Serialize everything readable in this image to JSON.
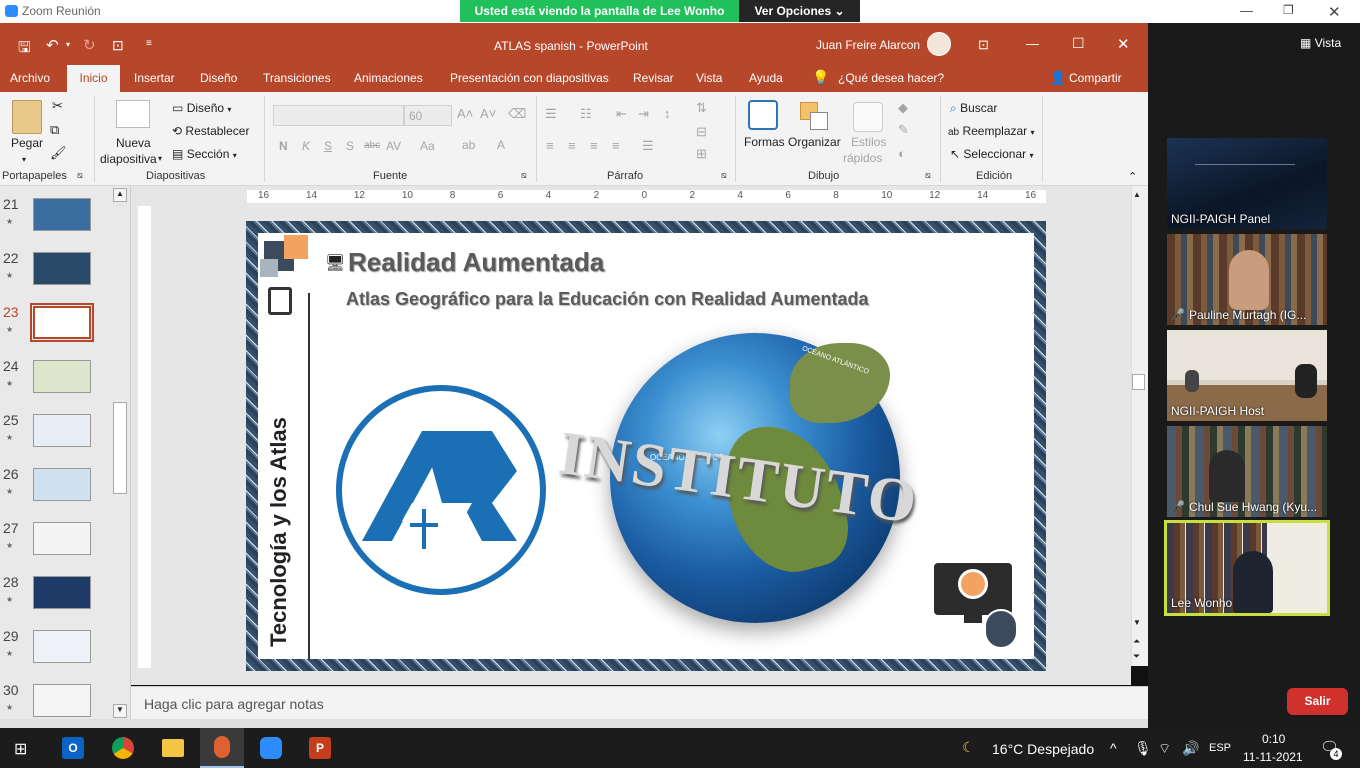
{
  "zoom": {
    "window_title": "Zoom Reunión",
    "share_banner": "Usted está viendo la pantalla de Lee Wonho",
    "view_options": "Ver Opciones",
    "view_label": "Vista",
    "leave_label": "Salir",
    "participants": [
      {
        "name": "NGII-PAIGH Panel",
        "muted": false
      },
      {
        "name": "Pauline Murtagh (IG...",
        "muted": true
      },
      {
        "name": "NGII-PAIGH Host",
        "muted": false
      },
      {
        "name": "Chul Sue Hwang (Kyu...",
        "muted": true
      },
      {
        "name": "Lee Wonho",
        "muted": false,
        "active_speaker": true
      }
    ]
  },
  "powerpoint": {
    "title": "ATLAS spanish  -  PowerPoint",
    "user": "Juan Freire Alarcon",
    "tabs": [
      "Archivo",
      "Inicio",
      "Insertar",
      "Diseño",
      "Transiciones",
      "Animaciones",
      "Presentación con diapositivas",
      "Revisar",
      "Vista",
      "Ayuda",
      "¿Qué desea hacer?"
    ],
    "share_label": "Compartir",
    "ribbon": {
      "paste": "Pegar",
      "new_slide_1": "Nueva",
      "new_slide_2": "diapositiva",
      "design": "Diseño",
      "reset": "Restablecer",
      "section": "Sección",
      "font_size": "60",
      "shapes": "Formas",
      "arrange": "Organizar",
      "quick_styles_1": "Estilos",
      "quick_styles_2": "rápidos",
      "find": "Buscar",
      "replace": "Reemplazar",
      "select": "Seleccionar",
      "groups": [
        "Portapapeles",
        "Diapositivas",
        "Fuente",
        "Párrafo",
        "Dibujo",
        "Edición"
      ]
    },
    "ruler_ticks": [
      "16",
      "14",
      "12",
      "10",
      "8",
      "6",
      "4",
      "2",
      "0",
      "2",
      "4",
      "6",
      "8",
      "10",
      "12",
      "14",
      "16"
    ],
    "slides": [
      {
        "num": "21",
        "star": "★"
      },
      {
        "num": "22",
        "star": "★"
      },
      {
        "num": "23",
        "star": "★",
        "selected": true
      },
      {
        "num": "24",
        "star": "★"
      },
      {
        "num": "25",
        "star": "★"
      },
      {
        "num": "26",
        "star": "★"
      },
      {
        "num": "27",
        "star": "★"
      },
      {
        "num": "28",
        "star": "★"
      },
      {
        "num": "29",
        "star": "★"
      },
      {
        "num": "30",
        "star": "★"
      }
    ],
    "slide_content": {
      "title": "Realidad Aumentada",
      "subtitle": "Atlas Geográfico para la Educación con Realidad Aumentada",
      "vertical_title": "Tecnología y los Atlas",
      "ocean_label": "OCÉANO PACÍFICO",
      "ocean_label_2": "OCÉANO ATLÁNTICO",
      "ring_text": "INSTITUTO",
      "logo_letters": "AR",
      "accent_color": "#e07b39",
      "navy_color": "#3b4a5c",
      "logo_blue": "#1a6fb5"
    },
    "notes_placeholder": "Haga clic para agregar notas"
  },
  "taskbar": {
    "weather": "16°C  Despejado",
    "lang": "ESP",
    "time": "0:10",
    "date": "11-11-2021",
    "notifications": "4"
  }
}
